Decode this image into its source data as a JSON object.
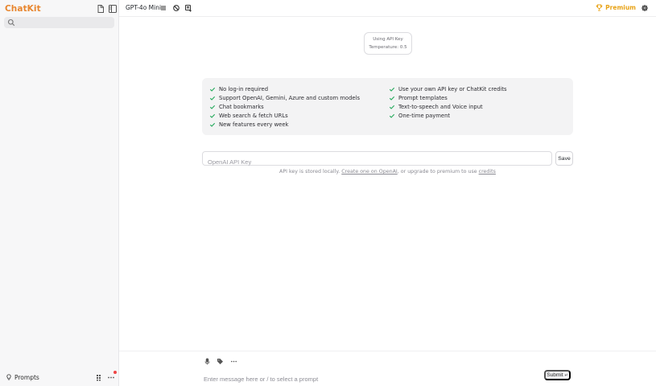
{
  "sidebar": {
    "brand": "ChatKit",
    "icons": {
      "new_chat": "new-chat-icon",
      "toggle": "sidebar-toggle-icon"
    },
    "search": {
      "value": "",
      "placeholder": "",
      "icon": "search-icon"
    },
    "bottom": {
      "prompts_label": "Prompts",
      "prompts_icon": "bulb-icon",
      "list_icon": "list-icon",
      "more_icon": "more-icon",
      "badge_color": "#ef4444"
    }
  },
  "topbar": {
    "model": "GPT-4o Mini",
    "icons": [
      "menu-icon",
      "block-icon",
      "add-chat-icon"
    ],
    "premium_label": "Premium",
    "premium_color": "#e8a317",
    "settings_icon": "gear-icon"
  },
  "api_status": {
    "line1": "Using API Key",
    "line2": "Temperature: 0.5"
  },
  "features": {
    "left": [
      "No log-in required",
      "Support OpenAI, Gemini, Azure and custom models",
      "Chat bookmarks",
      "Web search & fetch URLs",
      "New features every week"
    ],
    "right": [
      "Use your own API key or ChatKit credits",
      "Prompt templates",
      "Text-to-speech and Voice input",
      "One-time payment"
    ],
    "check_color": "#22a95a"
  },
  "api_key": {
    "value": "",
    "placeholder": "OpenAI API Key",
    "save_label": "Save",
    "note_prefix": "API key is stored locally.",
    "note_link1": "Create one on OpenAI",
    "note_middle": ", or upgrade to premium to use",
    "note_link2": "credits"
  },
  "composer": {
    "icons": [
      "microphone-icon",
      "tag-icon",
      "more-icon"
    ],
    "value": "",
    "placeholder": "Enter message here or / to select a prompt",
    "submit_label": "Submit",
    "submit_icon": "enter-icon"
  },
  "colors": {
    "brand": "#e8862f",
    "sidebar_bg": "#f7f7f8",
    "card_bg": "#f3f3f4"
  }
}
